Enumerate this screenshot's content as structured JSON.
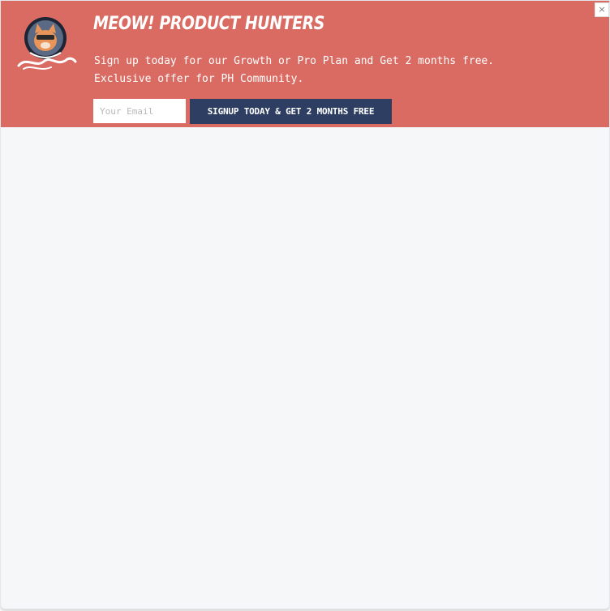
{
  "banner": {
    "background_color": "#d96b62",
    "headline": "MEOW! PRODUCT HUNTERS",
    "subtext_line1": "Sign up today for our Growth or Pro Plan and Get 2 months free.",
    "subtext_line2": "Exclusive offer for PH Community.",
    "logo_icon": "cat-astronaut-logo-icon"
  },
  "signup_form": {
    "email_placeholder": "Your Email",
    "button_label": "SIGNUP TODAY & GET 2 MONTHS FREE",
    "button_color": "#2d3e62"
  },
  "close": {
    "label": "×"
  },
  "page": {
    "background_color": "#f6f7f9"
  }
}
